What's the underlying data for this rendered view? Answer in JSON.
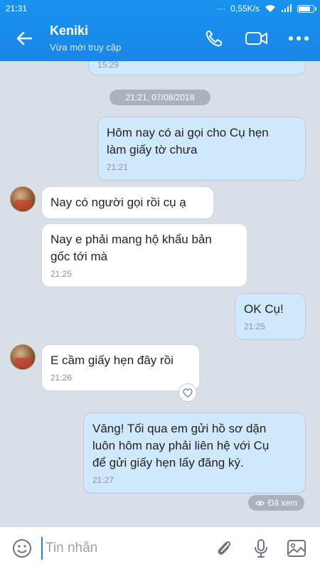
{
  "status_bar": {
    "time": "21:31",
    "network_speed": "0,55K/s"
  },
  "header": {
    "name": "Keniki",
    "status": "Vừa mới truy cập"
  },
  "messages": {
    "prev_time": "15:29",
    "date_separator": "21:21, 07/08/2018",
    "m1": {
      "text1": "Hôm nay có ai gọi cho Cụ hẹn",
      "text2": "làm giấy tờ chưa",
      "time": "21:21"
    },
    "m2": {
      "text": "Nay có người gọi rồi cụ ạ"
    },
    "m3": {
      "text1": "Nay e phải mang hộ khẩu bản",
      "text2": "gốc tới mà",
      "time": "21:25"
    },
    "m4": {
      "text": "OK Cụ!",
      "time": "21:25"
    },
    "m5": {
      "text": "E cầm giấy hẹn đây rồi",
      "time": "21:26"
    },
    "m6": {
      "text1": "Vâng! Tối qua em gửi hồ sơ dặn",
      "text2": "luôn hôm nay phải liên hệ với Cụ",
      "text3": "để gửi giấy hẹn lấy đăng ký.",
      "time": "21:27"
    },
    "seen": "Đã xem"
  },
  "input": {
    "placeholder": "Tin nhắn"
  },
  "colors": {
    "header": "#1a86e8",
    "outgoing_bubble": "#cfe8fb",
    "incoming_bubble": "#ffffff",
    "chat_bg": "#d9dfe7"
  }
}
